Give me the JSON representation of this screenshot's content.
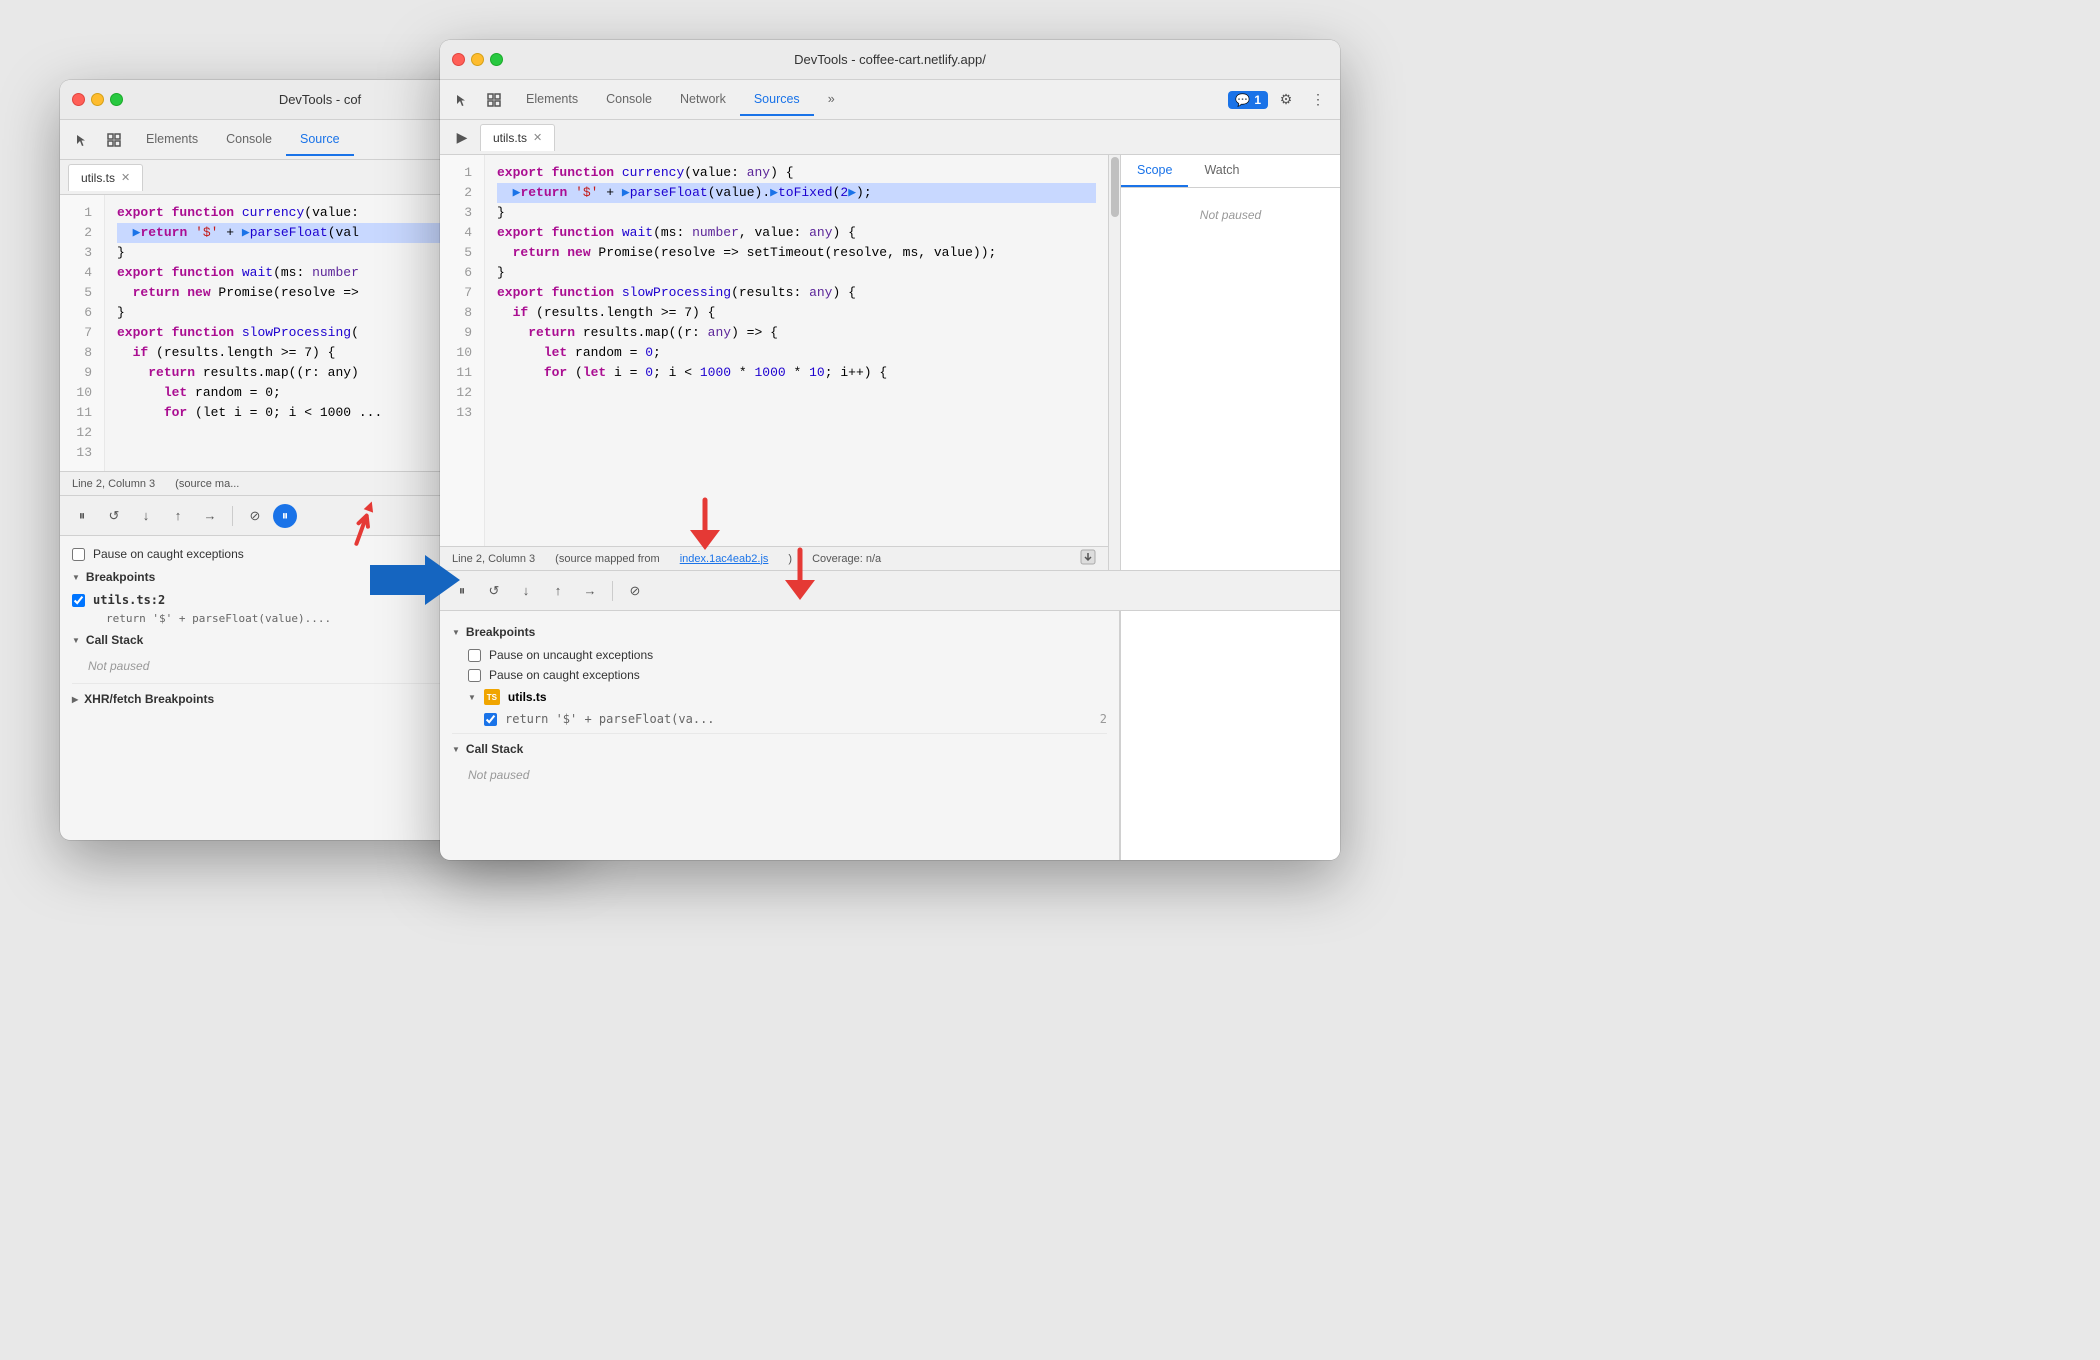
{
  "background_color": "#e0e0e0",
  "windows": {
    "back": {
      "title": "DevTools - cof",
      "tabs": [
        "Elements",
        "Console",
        "Source"
      ],
      "active_tab": "Source",
      "file_tab": "utils.ts",
      "code_lines": [
        {
          "num": 1,
          "code": "export function currency(value:"
        },
        {
          "num": 2,
          "code": "  ▶return '$' + ▶parseFloat(val",
          "highlighted": true
        },
        {
          "num": 3,
          "code": "}"
        },
        {
          "num": 4,
          "code": ""
        },
        {
          "num": 5,
          "code": "export function wait(ms: number"
        },
        {
          "num": 6,
          "code": "  return new Promise(resolve =>"
        },
        {
          "num": 7,
          "code": "}"
        },
        {
          "num": 8,
          "code": ""
        },
        {
          "num": 9,
          "code": "export function slowProcessing("
        },
        {
          "num": 10,
          "code": "  if (results.length >= 7) {"
        },
        {
          "num": 11,
          "code": "    return results.map((r: any)"
        },
        {
          "num": 12,
          "code": "      let random = 0;"
        },
        {
          "num": 13,
          "code": "      for (let i = 0; i < 1000 ..."
        }
      ],
      "status_bar": "Line 2, Column 3",
      "status_right": "(source ma...",
      "debug_buttons": [
        "pause",
        "resume",
        "step-over",
        "step-into",
        "step-out",
        "more",
        "breakpoints",
        "pause-blue"
      ],
      "bottom": {
        "pause_on_caught": "Pause on caught exceptions",
        "breakpoints_header": "Breakpoints",
        "bp_item": {
          "filename": "utils.ts:2",
          "code": "return '$' + parseFloat(value)...."
        },
        "call_stack_header": "Call Stack",
        "not_paused": "Not paused",
        "xhr_header": "XHR/fetch Breakpoints"
      }
    },
    "front": {
      "title": "DevTools - coffee-cart.netlify.app/",
      "tabs": [
        "Elements",
        "Console",
        "Network",
        "Sources"
      ],
      "active_tab": "Sources",
      "file_tab": "utils.ts",
      "code_lines": [
        {
          "num": 1,
          "code": "export function currency(value: any) {"
        },
        {
          "num": 2,
          "code": "  ▶return '$' + ▶parseFloat(value).▶toFixed(2▶);",
          "highlighted": true
        },
        {
          "num": 3,
          "code": "}"
        },
        {
          "num": 4,
          "code": ""
        },
        {
          "num": 5,
          "code": "export function wait(ms: number, value: any) {"
        },
        {
          "num": 6,
          "code": "  return new Promise(resolve => setTimeout(resolve, ms, value));"
        },
        {
          "num": 7,
          "code": "}"
        },
        {
          "num": 8,
          "code": ""
        },
        {
          "num": 9,
          "code": "export function slowProcessing(results: any) {"
        },
        {
          "num": 10,
          "code": "  if (results.length >= 7) {"
        },
        {
          "num": 11,
          "code": "    return results.map((r: any) => {"
        },
        {
          "num": 12,
          "code": "      let random = 0;"
        },
        {
          "num": 13,
          "code": "      for (let i = 0; i < 1000 * 1000 * 10; i++) {"
        }
      ],
      "status_bar": "Line 2, Column 3",
      "status_middle": "(source mapped from",
      "status_link": "index.1ac4eab2.js",
      "status_right": "Coverage: n/a",
      "bottom": {
        "breakpoints_header": "Breakpoints",
        "pause_uncaught": "Pause on uncaught exceptions",
        "pause_caught": "Pause on caught exceptions",
        "file_icon": "TS",
        "filename": "utils.ts",
        "bp_code": "return '$' + parseFloat(va...",
        "bp_line": "2",
        "call_stack_header": "Call Stack",
        "not_paused": "Not paused"
      },
      "right_panel": {
        "tabs": [
          "Scope",
          "Watch"
        ],
        "active_tab": "Scope",
        "not_paused": "Not paused"
      }
    }
  },
  "arrows": {
    "red_bottom_left": "↙",
    "red_bottom_right": "↙",
    "blue_right": "→"
  }
}
